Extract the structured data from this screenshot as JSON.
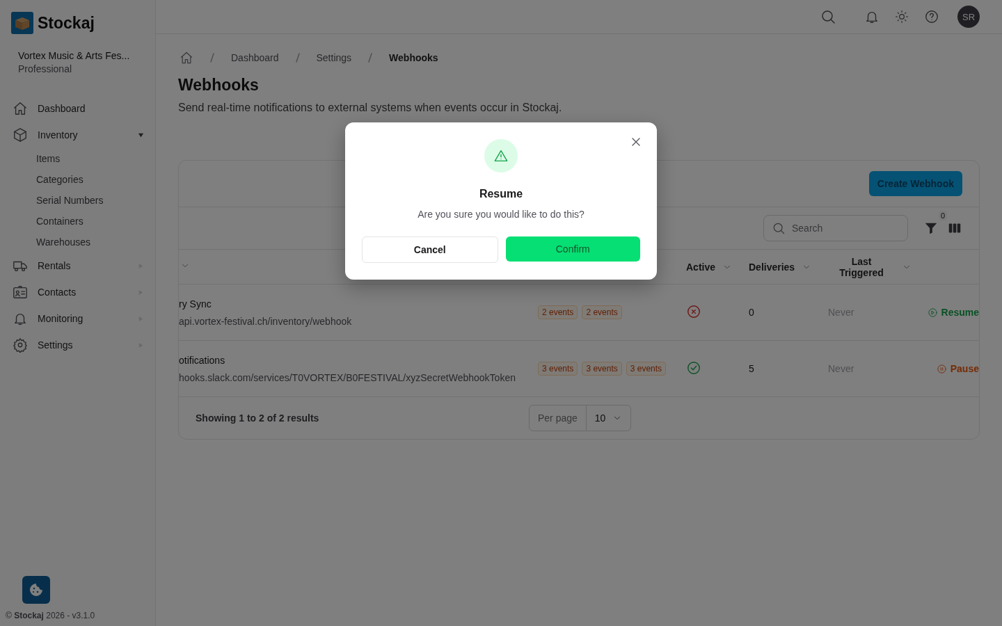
{
  "app": {
    "name": "Stockaj",
    "org": "Vortex Music & Arts Fes...",
    "plan": "Professional"
  },
  "sidebar": {
    "items": [
      {
        "label": "Dashboard",
        "kind": "link"
      },
      {
        "label": "Inventory",
        "kind": "group",
        "expanded": true,
        "children": [
          {
            "label": "Items"
          },
          {
            "label": "Categories"
          },
          {
            "label": "Serial Numbers"
          },
          {
            "label": "Containers"
          },
          {
            "label": "Warehouses"
          }
        ]
      },
      {
        "label": "Rentals",
        "kind": "group",
        "expanded": false
      },
      {
        "label": "Contacts",
        "kind": "group",
        "expanded": false
      },
      {
        "label": "Monitoring",
        "kind": "group",
        "expanded": false
      },
      {
        "label": "Settings",
        "kind": "group",
        "expanded": false
      }
    ]
  },
  "footer": {
    "copyright": "© **Stockaj** 2026 - v3.1.0"
  },
  "topbar": {
    "avatar": "SR"
  },
  "breadcrumb": [
    "Dashboard",
    "Settings",
    "Webhooks"
  ],
  "page": {
    "title": "Webhooks",
    "description": "Send real-time notifications to external systems when events occur in Stockaj."
  },
  "toolbar": {
    "create_button": "Create Webhook",
    "search": {
      "placeholder": "Search"
    },
    "filter_count": "0"
  },
  "table": {
    "columns": [
      "Active",
      "Deliveries",
      "Last Triggered"
    ],
    "rows": [
      {
        "name": "ry Sync",
        "url": "api.vortex-festival.ch/inventory/webhook",
        "events": [
          "2 events",
          "2 events"
        ],
        "active": false,
        "deliveries": "0",
        "last_triggered": "Never",
        "action": {
          "label": "Resume",
          "kind": "resume"
        }
      },
      {
        "name": "otifications",
        "url": "hooks.slack.com/services/T0VORTEX/B0FESTIVAL/xyzSecretWebhookToken",
        "events": [
          "3 events",
          "3 events",
          "3 events"
        ],
        "active": true,
        "deliveries": "5",
        "last_triggered": "Never",
        "action": {
          "label": "Pause",
          "kind": "pause"
        }
      }
    ]
  },
  "pagination": {
    "summary": "Showing 1 to 2 of 2 results",
    "per_page_label": "Per page",
    "per_page": "10"
  },
  "dialog": {
    "title": "Resume",
    "message": "Are you sure you would like to do this?",
    "cancel": "Cancel",
    "confirm": "Confirm"
  }
}
